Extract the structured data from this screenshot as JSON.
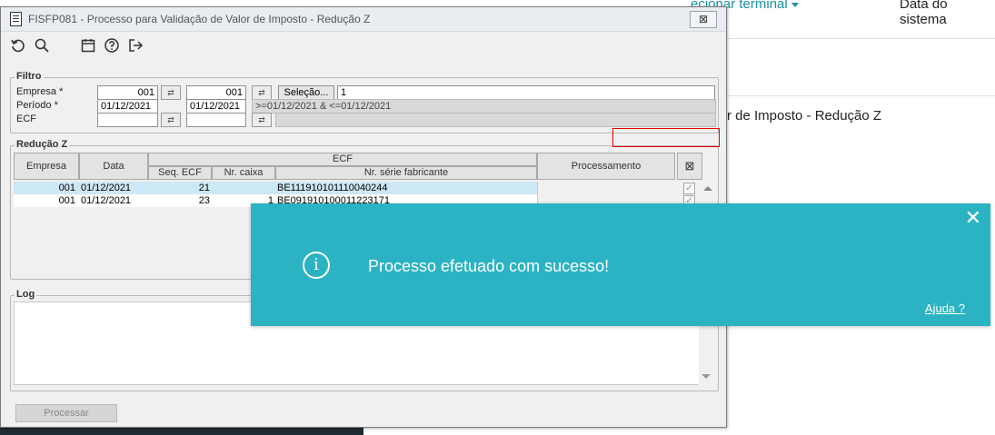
{
  "background": {
    "nav_link": "ecionar terminal",
    "system_label": "Data do sistema",
    "page_title": "r de Imposto - Redução Z"
  },
  "window": {
    "title": "FISFP081 - Processo para Validação de Valor de Imposto - Redução Z",
    "close_label": "⊠"
  },
  "toolbar": {
    "icons": [
      "undo-icon",
      "search-icon",
      "calendar-icon",
      "help-icon",
      "exit-icon"
    ]
  },
  "filtro": {
    "title": "Filtro",
    "empresa_label": "Empresa *",
    "empresa_from": "001",
    "empresa_to": "001",
    "periodo_label": "Período *",
    "periodo_from": "01/12/2021",
    "periodo_to": "01/12/2021",
    "ecf_label": "ECF",
    "selecao_label": "Seleção...",
    "selecao_value": "1",
    "periodo_expr": ">=01/12/2021 & <=01/12/2021"
  },
  "reducao": {
    "title": "Redução Z",
    "headers": {
      "empresa": "Empresa",
      "data": "Data",
      "ecf": "ECF",
      "seq_ecf": "Seq. ECF",
      "nr_caixa": "Nr. caixa",
      "nr_serie": "Nr. série fabricante",
      "processamento": "Processamento"
    },
    "rows": [
      {
        "empresa": "001",
        "data": "01/12/2021",
        "seq_ecf": "21",
        "nr_caixa": "",
        "nr_serie": "BE111910101110040244"
      },
      {
        "empresa": "001",
        "data": "01/12/2021",
        "seq_ecf": "23",
        "nr_caixa": "1",
        "nr_serie": "BE091910100011223171"
      }
    ]
  },
  "log": {
    "title": "Log"
  },
  "footer": {
    "process_label": "Processar"
  },
  "toast": {
    "message": "Processo efetuado com sucesso!",
    "help_label": "Ajuda ?",
    "close_label": "✕",
    "color": "#2bb3c3"
  }
}
